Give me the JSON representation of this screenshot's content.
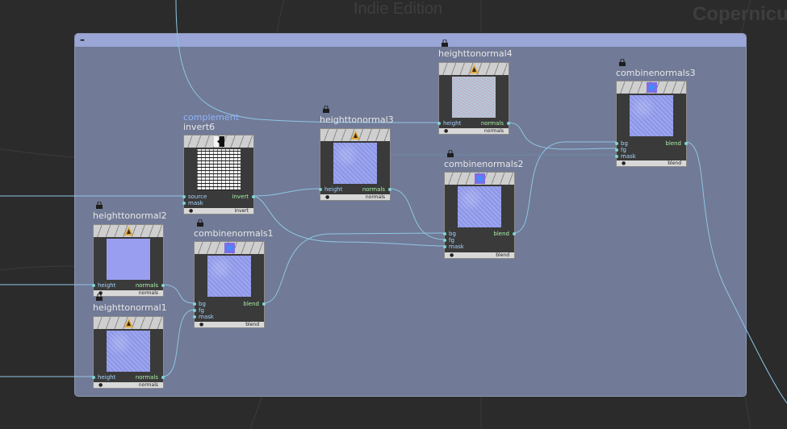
{
  "watermarks": {
    "edition": "Indie Edition",
    "app": "Copernicu"
  },
  "colors": {
    "netbox": "#717a96",
    "wire": "#8ec6e6",
    "port_dot": "#7fd3d3"
  },
  "nodes": {
    "heighttonormal4": {
      "name": "heighttonormal4",
      "inputs": [
        "height"
      ],
      "outputs": [
        "normals"
      ],
      "footer": "normals",
      "icon": "heighttonormal-icon"
    },
    "combinenormals3": {
      "name": "combinenormals3",
      "inputs": [
        "bg",
        "fg",
        "mask"
      ],
      "outputs": [
        "blend"
      ],
      "footer": "blend",
      "icon": "combinenormals-icon"
    },
    "invert6": {
      "name": "invert6",
      "comment": "complement",
      "inputs": [
        "source",
        "mask"
      ],
      "outputs": [
        "invert"
      ],
      "footer": "invert",
      "icon": "invert-icon"
    },
    "heighttonormal3": {
      "name": "heighttonormal3",
      "inputs": [
        "height"
      ],
      "outputs": [
        "normals"
      ],
      "footer": "normals",
      "icon": "heighttonormal-icon"
    },
    "combinenormals2": {
      "name": "combinenormals2",
      "inputs": [
        "bg",
        "fg",
        "mask"
      ],
      "outputs": [
        "blend"
      ],
      "footer": "blend",
      "icon": "combinenormals-icon"
    },
    "heighttonormal2": {
      "name": "heighttonormal2",
      "inputs": [
        "height"
      ],
      "outputs": [
        "normals"
      ],
      "footer": "normals",
      "icon": "heighttonormal-icon"
    },
    "combinenormals1": {
      "name": "combinenormals1",
      "inputs": [
        "bg",
        "fg",
        "mask"
      ],
      "outputs": [
        "blend"
      ],
      "footer": "blend",
      "icon": "combinenormals-icon"
    },
    "heighttonormal1": {
      "name": "heighttonormal1",
      "inputs": [
        "height"
      ],
      "outputs": [
        "normals"
      ],
      "footer": "normals",
      "icon": "heighttonormal-icon"
    }
  }
}
